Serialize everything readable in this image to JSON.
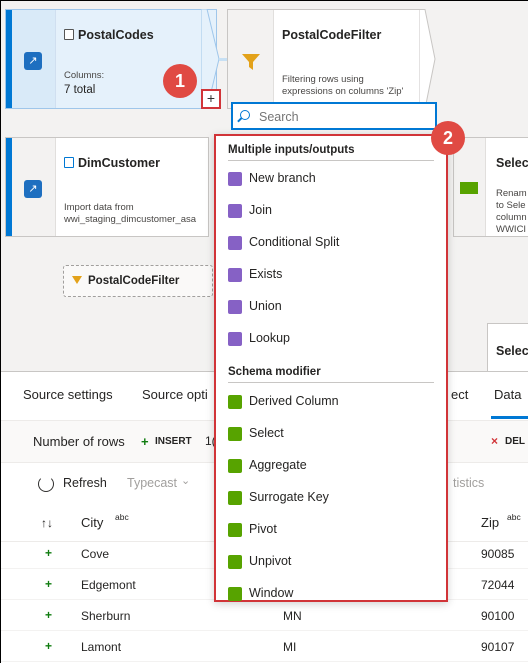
{
  "canvas": {
    "source1": {
      "title": "PostalCodes",
      "columns_label": "Columns:",
      "columns_value": "7 total"
    },
    "filter_node": {
      "title": "PostalCodeFilter",
      "desc_line1": "Filtering rows using",
      "desc_line2": "expressions on columns 'Zip'"
    },
    "source2": {
      "title": "DimCustomer",
      "desc_line1": "Import data from",
      "desc_line2": "wwi_staging_dimcustomer_asa"
    },
    "filter_chip": "PostalCodeFilter",
    "select_node": {
      "title": "Select",
      "desc_lines": [
        "Renam",
        "to Sele",
        "column",
        "WWICI"
      ]
    },
    "select_node2_title": "Select",
    "plus_label": "+",
    "badge1": "1",
    "badge2": "2"
  },
  "dropdown": {
    "search_placeholder": "Search",
    "section1": "Multiple inputs/outputs",
    "section1_items": [
      {
        "label": "New branch",
        "icon": "new-branch-icon",
        "color": "#8661c5"
      },
      {
        "label": "Join",
        "icon": "join-icon",
        "color": "#8661c5"
      },
      {
        "label": "Conditional Split",
        "icon": "conditional-split-icon",
        "color": "#8661c5"
      },
      {
        "label": "Exists",
        "icon": "exists-icon",
        "color": "#8661c5"
      },
      {
        "label": "Union",
        "icon": "union-icon",
        "color": "#8661c5"
      },
      {
        "label": "Lookup",
        "icon": "lookup-icon",
        "color": "#8661c5"
      }
    ],
    "section2": "Schema modifier",
    "section2_items": [
      {
        "label": "Derived Column",
        "icon": "derived-column-icon",
        "color": "#57a300"
      },
      {
        "label": "Select",
        "icon": "select-icon",
        "color": "#57a300"
      },
      {
        "label": "Aggregate",
        "icon": "aggregate-icon",
        "color": "#57a300"
      },
      {
        "label": "Surrogate Key",
        "icon": "surrogate-key-icon",
        "color": "#57a300"
      },
      {
        "label": "Pivot",
        "icon": "pivot-icon",
        "color": "#57a300"
      },
      {
        "label": "Unpivot",
        "icon": "unpivot-icon",
        "color": "#57a300"
      },
      {
        "label": "Window",
        "icon": "window-icon",
        "color": "#57a300"
      }
    ]
  },
  "bottom": {
    "tabs": [
      "Source settings",
      "Source opti",
      "ect",
      "Data"
    ],
    "rows_label": "Number of rows",
    "insert_label": "INSERT",
    "insert_count_fragment": "1(",
    "delete_label": "DEL",
    "refresh_label": "Refresh",
    "typecast_label": "Typecast",
    "statistics_fragment": "tistics",
    "columns": {
      "sort_glyph": "↑↓",
      "city": "City",
      "city_type": "abc",
      "zip": "Zip",
      "zip_type": "abc"
    },
    "rows": [
      {
        "city": "Cove",
        "state": "",
        "zip": "90085"
      },
      {
        "city": "Edgemont",
        "state": "",
        "zip": "72044"
      },
      {
        "city": "Sherburn",
        "state": "MN",
        "zip": "90100"
      },
      {
        "city": "Lamont",
        "state": "MI",
        "zip": "90107"
      }
    ]
  },
  "colors": {
    "accent": "#0078d4",
    "highlight_red": "#d13438",
    "badge": "#e04a43",
    "insert_green": "#107c10"
  }
}
